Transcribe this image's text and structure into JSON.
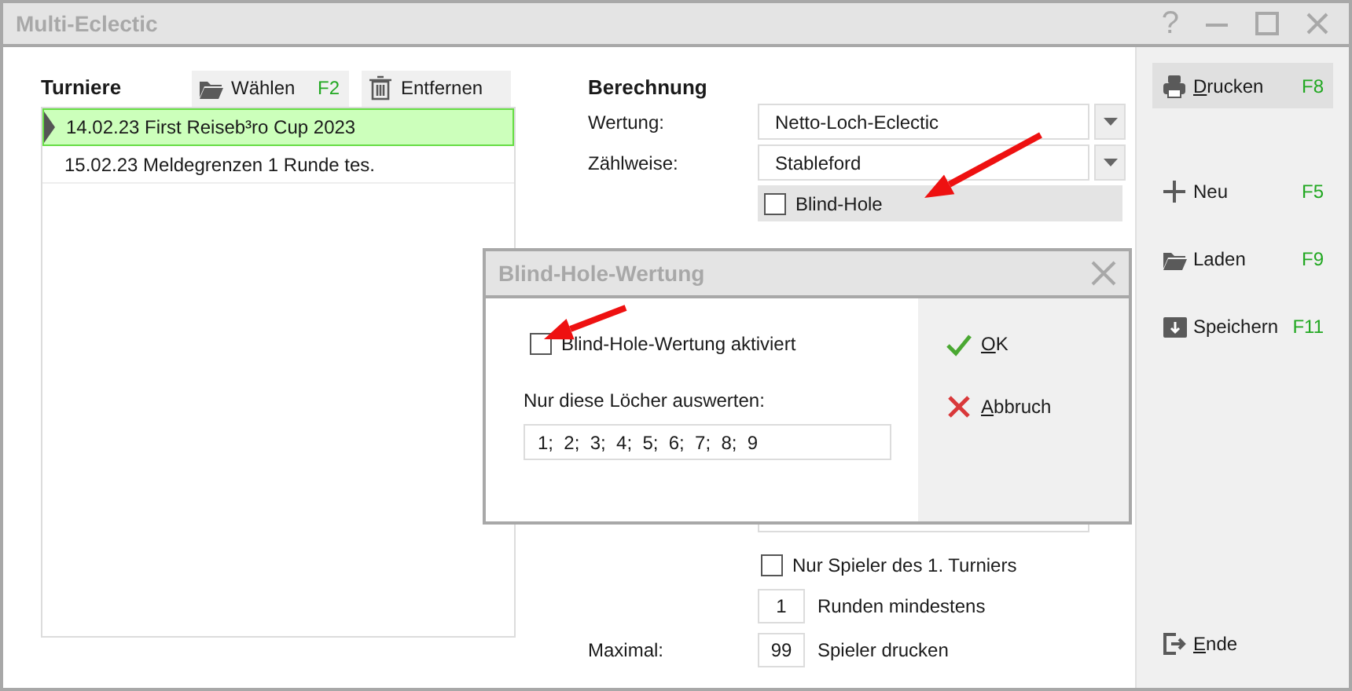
{
  "window": {
    "title": "Multi-Eclectic",
    "controls": [
      "?"
    ]
  },
  "tournaments": {
    "heading": "Turniere",
    "buttons": [
      {
        "label": "Wählen",
        "key": "F2"
      },
      {
        "label": "Entfernen"
      }
    ],
    "rows": [
      {
        "label": "14.02.23 First Reiseb³ro Cup 2023",
        "selected": true
      },
      {
        "label": "15.02.23 Meldegrenzen 1 Runde tes.",
        "selected": false
      }
    ]
  },
  "calculation": {
    "heading": "Berechnung",
    "fields": [
      {
        "label": "Wertung:",
        "value": "Netto-Loch-Eclectic"
      },
      {
        "label": "Zählweise:",
        "value": "Stableford"
      }
    ],
    "blind_hole": {
      "label": "Blind-Hole",
      "checked": false
    },
    "only_first": {
      "label": "Nur Spieler des 1. Turniers",
      "checked": false
    },
    "min_rounds": {
      "value": "1",
      "label": "Runden mindestens"
    },
    "maximum": {
      "label": "Maximal:",
      "value": "99",
      "suffix": "Spieler drucken"
    }
  },
  "actions": [
    {
      "label": "Drucken",
      "key": "F8",
      "selected": true,
      "mnemonic": true
    },
    {
      "label": "Neu",
      "key": "F5",
      "selected": false,
      "mnemonic": false
    },
    {
      "label": "Laden",
      "key": "F9",
      "selected": false,
      "mnemonic": false
    },
    {
      "label": "Speichern",
      "key": "F11",
      "selected": false,
      "mnemonic": false
    },
    {
      "label": "Ende",
      "selected": false,
      "mnemonic": true
    }
  ],
  "dialog": {
    "title": "Blind-Hole-Wertung",
    "checkbox": {
      "label": "Blind-Hole-Wertung aktiviert",
      "checked": false
    },
    "holes_label": "Nur diese Löcher auswerten:",
    "holes_value": "1;  2;  3;  4;  5;  6;  7;  8;  9",
    "buttons": [
      {
        "label": "OK",
        "mnemonic": true
      },
      {
        "label": "Abbruch",
        "mnemonic": true
      }
    ]
  },
  "annotations": [
    {
      "kind": "arrow"
    },
    {
      "kind": "arrow"
    }
  ]
}
